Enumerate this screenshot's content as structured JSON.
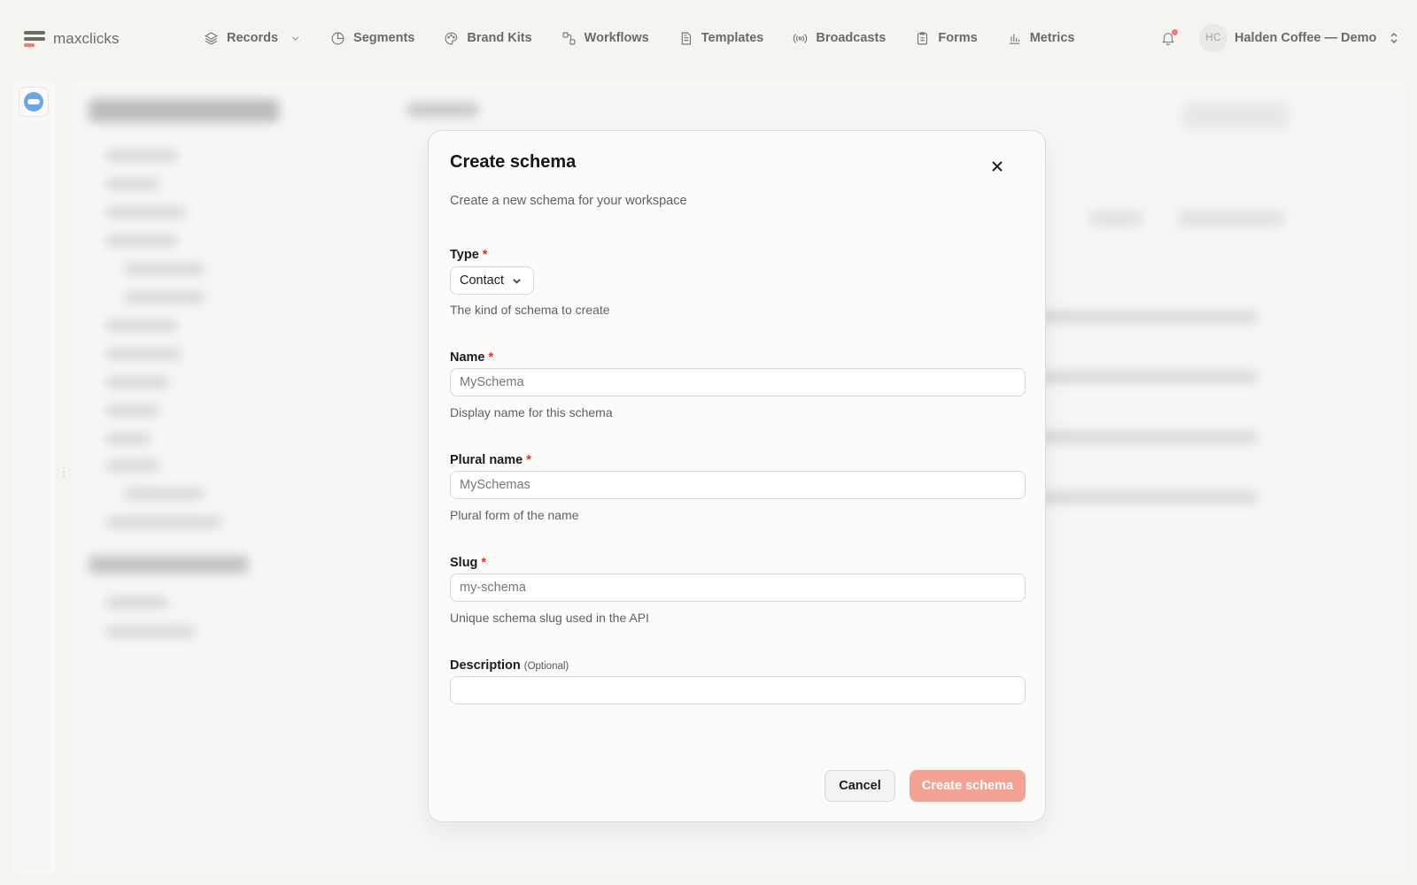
{
  "brand": {
    "name": "maxclicks"
  },
  "nav": {
    "items": [
      {
        "label": "Records",
        "icon": "layers-icon",
        "has_dropdown": true
      },
      {
        "label": "Segments",
        "icon": "pie-chart-icon"
      },
      {
        "label": "Brand Kits",
        "icon": "palette-icon"
      },
      {
        "label": "Workflows",
        "icon": "workflow-icon"
      },
      {
        "label": "Templates",
        "icon": "document-icon"
      },
      {
        "label": "Broadcasts",
        "icon": "broadcast-icon"
      },
      {
        "label": "Forms",
        "icon": "clipboard-icon"
      },
      {
        "label": "Metrics",
        "icon": "bar-chart-icon"
      }
    ],
    "notification_icon": "bell-icon",
    "workspace": {
      "initials": "HC",
      "name": "Halden Coffee — Demo"
    }
  },
  "modal": {
    "title": "Create schema",
    "description": "Create a new schema for your workspace",
    "type": {
      "label": "Type",
      "required_mark": "*",
      "selected": "Contact",
      "help": "The kind of schema to create"
    },
    "name": {
      "label": "Name",
      "required_mark": "*",
      "placeholder": "MySchema",
      "value": "",
      "help": "Display name for this schema"
    },
    "plural_name": {
      "label": "Plural name",
      "required_mark": "*",
      "placeholder": "MySchemas",
      "value": "",
      "help": "Plural form of the name"
    },
    "slug": {
      "label": "Slug",
      "required_mark": "*",
      "placeholder": "my-schema",
      "value": "",
      "help": "Unique schema slug used in the API"
    },
    "description_field": {
      "label": "Description",
      "optional_label": "(Optional)",
      "placeholder": "",
      "value": ""
    },
    "cancel_label": "Cancel",
    "submit_label": "Create schema"
  },
  "colors": {
    "accent": "#e8432d",
    "submit_disabled": "#f4a196",
    "required": "#d03a2a"
  }
}
